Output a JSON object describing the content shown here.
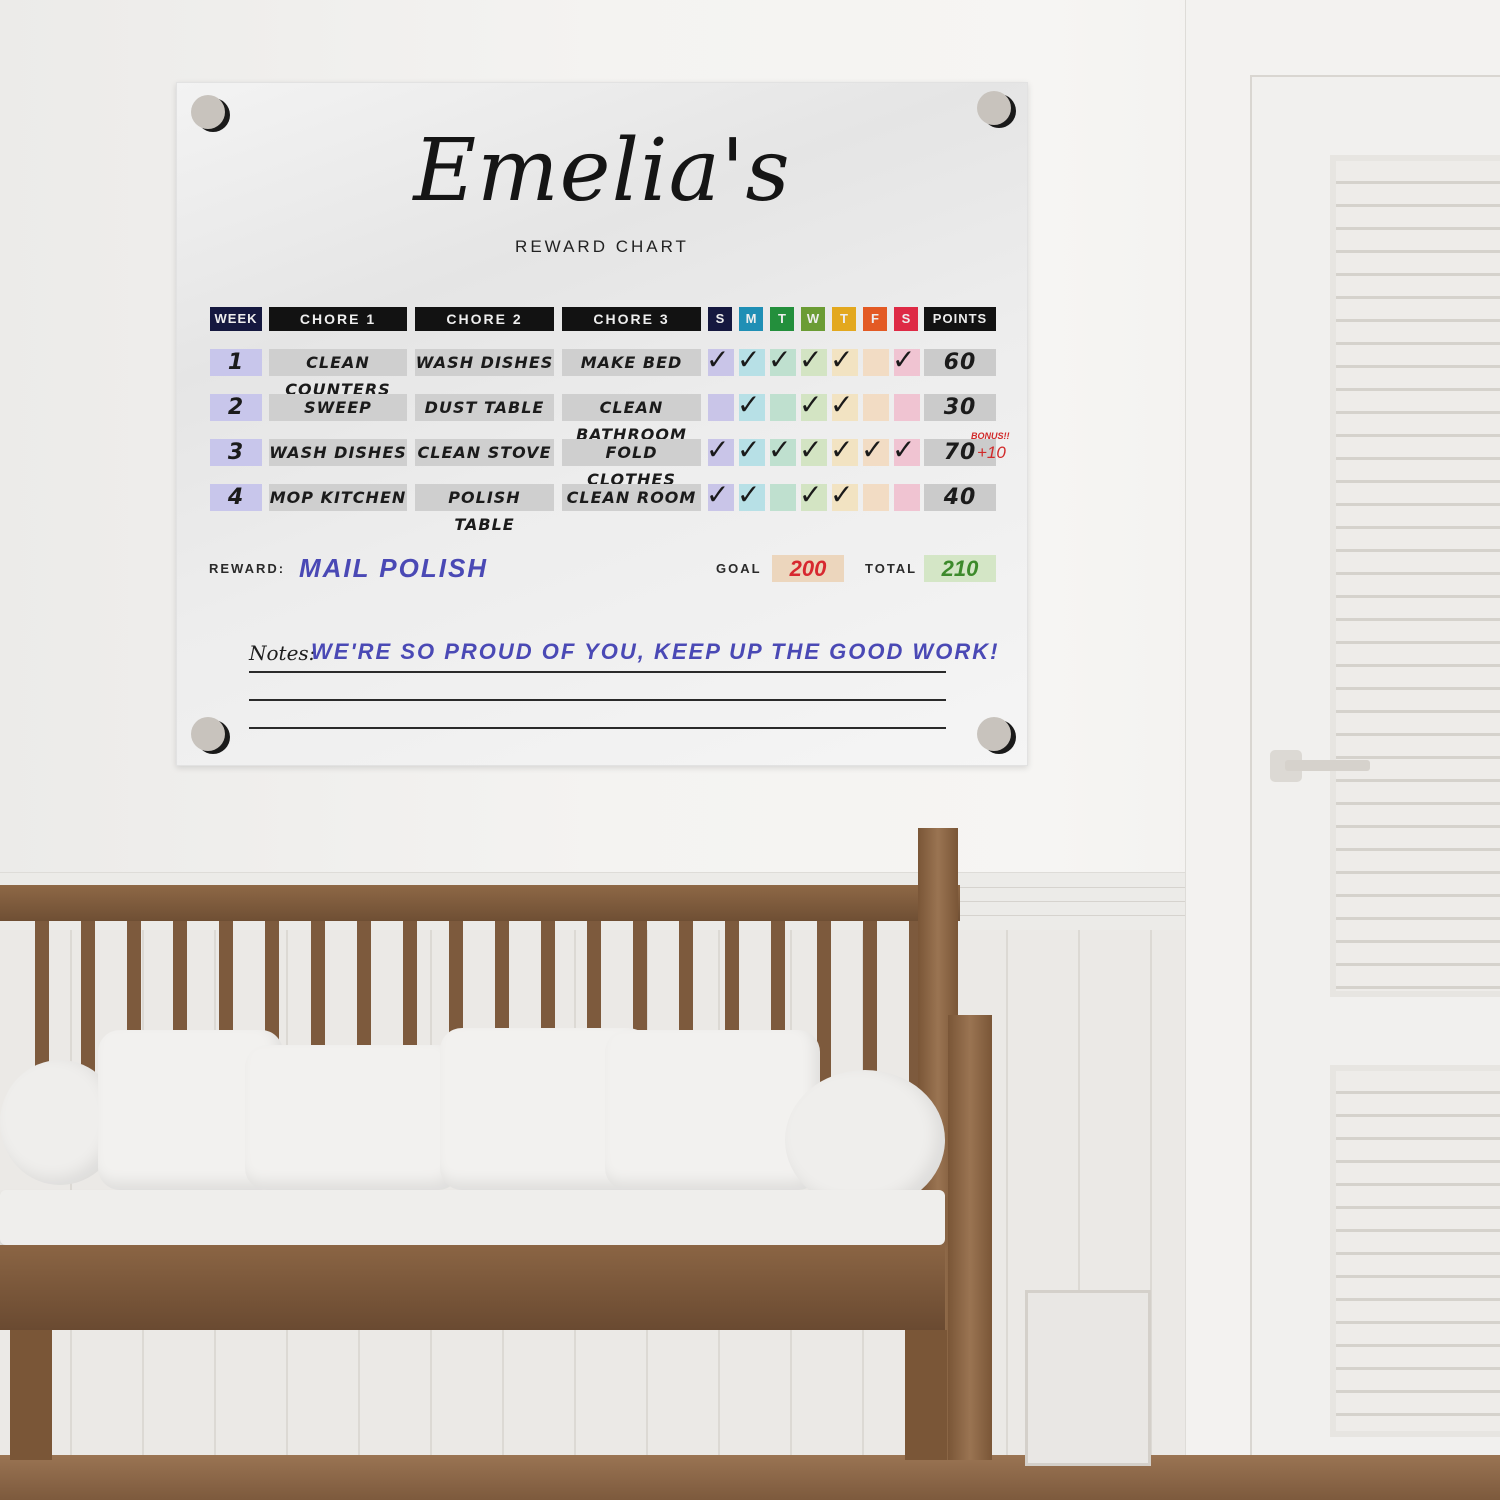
{
  "scene": {
    "description": "Acrylic wall-mounted chore reward chart above a wooden bench with white pillows, next to a white louvered door"
  },
  "chart": {
    "title": "Emelia's",
    "subtitle": "REWARD CHART",
    "headers": {
      "week": "WEEK",
      "chore1": "CHORE 1",
      "chore2": "CHORE 2",
      "chore3": "CHORE 3",
      "points": "POINTS"
    },
    "days": [
      {
        "label": "S",
        "color": "#15183f",
        "cell_color": "#c9c5e8"
      },
      {
        "label": "M",
        "color": "#1f8fb5",
        "cell_color": "#b7e0e6"
      },
      {
        "label": "T",
        "color": "#238f3c",
        "cell_color": "#bfe0cf"
      },
      {
        "label": "W",
        "color": "#6b9c34",
        "cell_color": "#d3e4c3"
      },
      {
        "label": "T",
        "color": "#e3a81e",
        "cell_color": "#f2e3c2"
      },
      {
        "label": "F",
        "color": "#e35a24",
        "cell_color": "#f2dcc4"
      },
      {
        "label": "S",
        "color": "#de2a45",
        "cell_color": "#f0c4d2"
      }
    ],
    "check_glyph": "✓",
    "rows": [
      {
        "week": "1",
        "chore1": "CLEAN COUNTERS",
        "chore2": "WASH DISHES",
        "chore3": "MAKE BED",
        "checks": [
          true,
          true,
          true,
          true,
          true,
          false,
          true
        ],
        "points": "60"
      },
      {
        "week": "2",
        "chore1": "SWEEP",
        "chore2": "DUST TABLE",
        "chore3": "CLEAN BATHROOM",
        "checks": [
          false,
          true,
          false,
          true,
          true,
          false,
          false
        ],
        "points": "30"
      },
      {
        "week": "3",
        "chore1": "WASH DISHES",
        "chore2": "CLEAN STOVE",
        "chore3": "FOLD CLOTHES",
        "checks": [
          true,
          true,
          true,
          true,
          true,
          true,
          true
        ],
        "points": "70",
        "bonus_label": "BONUS!!",
        "bonus_value": "+10"
      },
      {
        "week": "4",
        "chore1": "MOP KITCHEN",
        "chore2": "POLISH TABLE",
        "chore3": "CLEAN ROOM",
        "checks": [
          true,
          true,
          false,
          true,
          true,
          false,
          false
        ],
        "points": "40"
      }
    ],
    "reward_label": "REWARD:",
    "reward_value": "MAIL POLISH",
    "goal_label": "GOAL",
    "goal_value": "200",
    "goal_color": "#d7282f",
    "total_label": "TOTAL",
    "total_value": "210",
    "total_color": "#3d8a2b",
    "notes_label": "Notes:",
    "notes_value": "WE'RE SO PROUD OF YOU, KEEP UP THE GOOD WORK!",
    "accent_handwriting_color": "#4a49b5"
  }
}
